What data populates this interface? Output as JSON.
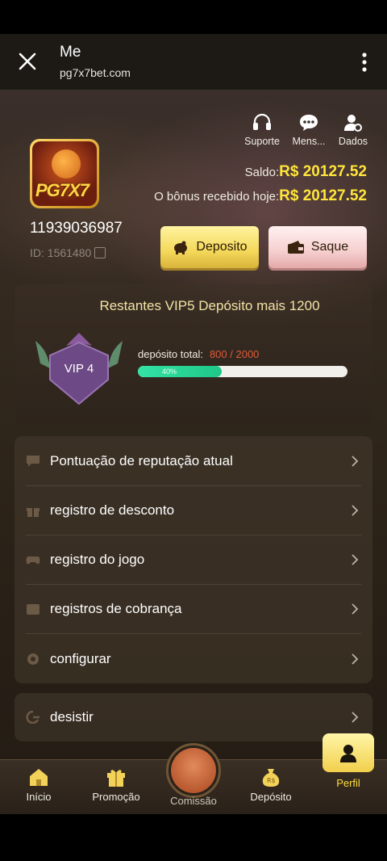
{
  "appbar": {
    "title": "Me",
    "url": "pg7x7bet.com"
  },
  "quick": [
    {
      "label": "Suporte",
      "icon": "headset-icon"
    },
    {
      "label": "Mens...",
      "icon": "message-icon"
    },
    {
      "label": "Dados",
      "icon": "user-settings-icon"
    }
  ],
  "logo": {
    "text": "PG7X7"
  },
  "user": {
    "phone": "11939036987",
    "id": "ID: 1561480"
  },
  "balance": {
    "label": "Saldo:",
    "value": "R$ 20127.52"
  },
  "bonus": {
    "label": "O bônus recebido hoje:",
    "value": "R$ 20127.52"
  },
  "actions": {
    "deposit": "Deposito",
    "withdraw": "Saque"
  },
  "vip": {
    "header": "Restantes VIP5 Depósito mais 1200",
    "level": "VIP 4",
    "total_label": "depósito total:",
    "total_value": "800 / 2000",
    "progress": 0.4,
    "progress_label": "40%"
  },
  "menu": [
    {
      "label": "Pontuação de reputação atual",
      "icon": "reputation-icon"
    },
    {
      "label": "registro de desconto",
      "icon": "gift-icon"
    },
    {
      "label": "registro do jogo",
      "icon": "gamepad-icon"
    },
    {
      "label": "registros de cobrança",
      "icon": "billing-icon"
    },
    {
      "label": "configurar",
      "icon": "settings-icon"
    }
  ],
  "logout": {
    "label": "desistir",
    "icon": "logout-icon"
  },
  "tabs": {
    "inicio": "Início",
    "promocao": "Promoção",
    "comissao": "Comissão",
    "deposito": "Depósito",
    "perfil": "Perfil"
  },
  "colors": {
    "accent": "#ffe53b",
    "progress": "#1fc787",
    "deposit_btn": "#f4d85a",
    "withdraw_btn": "#f6cfcf"
  }
}
